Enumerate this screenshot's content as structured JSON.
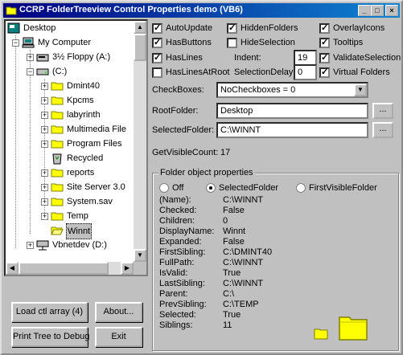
{
  "window": {
    "title": "CCRP FolderTreeview Control Properties demo (VB6)"
  },
  "tree": {
    "nodes": [
      {
        "label": "Desktop",
        "icon": "desktop-icon"
      },
      {
        "label": "My Computer",
        "icon": "computer-icon"
      },
      {
        "label": "3½ Floppy (A:)",
        "icon": "floppy-icon"
      },
      {
        "label": "(C:)",
        "icon": "drive-icon"
      },
      {
        "label": "Dmint40",
        "icon": "folder-icon"
      },
      {
        "label": "Kpcms",
        "icon": "folder-icon"
      },
      {
        "label": "labyrinth",
        "icon": "folder-icon"
      },
      {
        "label": "Multimedia File",
        "icon": "folder-icon"
      },
      {
        "label": "Program Files",
        "icon": "folder-icon"
      },
      {
        "label": "Recycled",
        "icon": "recycle-icon"
      },
      {
        "label": "reports",
        "icon": "folder-icon"
      },
      {
        "label": "Site Server 3.0",
        "icon": "folder-icon"
      },
      {
        "label": "System.sav",
        "icon": "folder-icon"
      },
      {
        "label": "Temp",
        "icon": "folder-icon"
      },
      {
        "label": "Winnt",
        "icon": "folder-open-icon"
      },
      {
        "label": "Vbnetdev (D:)",
        "icon": "netdrive-icon"
      }
    ]
  },
  "checkboxes": {
    "auto_update": {
      "label": "AutoUpdate",
      "checked": true
    },
    "hidden_folders": {
      "label": "HiddenFolders",
      "checked": true
    },
    "overlay_icons": {
      "label": "OverlayIcons",
      "checked": true
    },
    "has_buttons": {
      "label": "HasButtons",
      "checked": true
    },
    "hide_selection": {
      "label": "HideSelection",
      "checked": false
    },
    "tooltips": {
      "label": "Tooltips",
      "checked": true
    },
    "has_lines": {
      "label": "HasLines",
      "checked": true
    },
    "validate_selection": {
      "label": "ValidateSelection",
      "checked": true
    },
    "has_lines_at_root": {
      "label": "HasLinesAtRoot",
      "checked": false
    },
    "virtual_folders": {
      "label": "Virtual Folders",
      "checked": true
    }
  },
  "indent": {
    "label": "Indent:",
    "value": "19"
  },
  "selection_delay": {
    "label": "SelectionDelay:",
    "value": "0"
  },
  "checkboxes_combo": {
    "label": "CheckBoxes:",
    "value": "NoCheckboxes = 0"
  },
  "root_folder": {
    "label": "RootFolder:",
    "value": "Desktop",
    "button": "..."
  },
  "selected_folder": {
    "label": "SelectedFolder:",
    "value": "C:\\WINNT",
    "button": "..."
  },
  "visible_count": {
    "label": "GetVisibleCount:",
    "value": "17"
  },
  "folder_props": {
    "title": "Folder object properties",
    "radios": [
      {
        "label": "Off",
        "selected": false
      },
      {
        "label": "SelectedFolder",
        "selected": true
      },
      {
        "label": "FirstVisibleFolder",
        "selected": false
      }
    ],
    "rows": [
      {
        "name": "(Name):",
        "value": "C:\\WINNT"
      },
      {
        "name": "Checked:",
        "value": "False"
      },
      {
        "name": "Children:",
        "value": "0"
      },
      {
        "name": "DisplayName:",
        "value": "Winnt"
      },
      {
        "name": "Expanded:",
        "value": "False"
      },
      {
        "name": "FirstSibling:",
        "value": "C:\\DMINT40"
      },
      {
        "name": "FullPath:",
        "value": "C:\\WINNT"
      },
      {
        "name": "IsValid:",
        "value": "True"
      },
      {
        "name": "LastSibling:",
        "value": "C:\\WINNT"
      },
      {
        "name": "Parent:",
        "value": "C:\\"
      },
      {
        "name": "PrevSibling:",
        "value": "C:\\TEMP"
      },
      {
        "name": "Selected:",
        "value": "True"
      },
      {
        "name": "Siblings:",
        "value": "11"
      }
    ]
  },
  "buttons": {
    "load_ctl_array": "Load ctl array (4)",
    "about": "About...",
    "print_tree": "Print Tree to Debug",
    "exit": "Exit"
  },
  "colors": {
    "title_bar": "#000080",
    "folder_yellow": "#ffff00",
    "face": "#c0c0c0"
  }
}
